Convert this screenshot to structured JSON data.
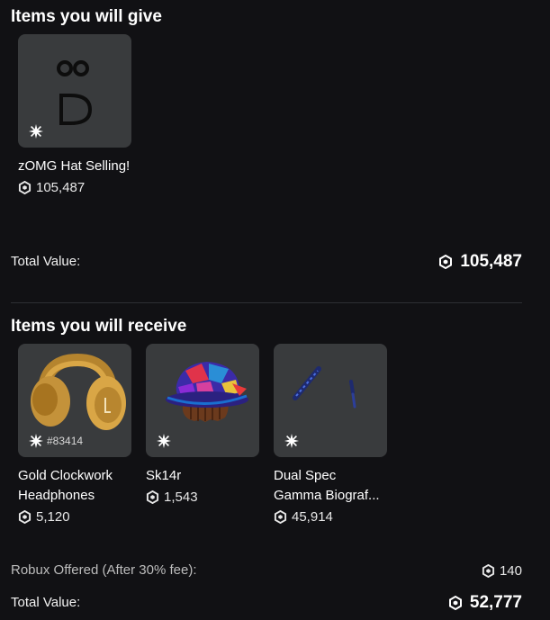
{
  "give": {
    "title": "Items you will give",
    "items": [
      {
        "name": "zOMG Hat Selling!",
        "price": "105,487",
        "serial": ""
      }
    ],
    "total_label": "Total Value:",
    "total_value": "105,487"
  },
  "receive": {
    "title": "Items you will receive",
    "items": [
      {
        "name": "Gold Clockwork Headphones",
        "price": "5,120",
        "serial": "#83414"
      },
      {
        "name": "Sk14r",
        "price": "1,543",
        "serial": ""
      },
      {
        "name": "Dual Spec Gamma Biograf...",
        "price": "45,914",
        "serial": ""
      }
    ],
    "robux_label": "Robux Offered (After 30% fee):",
    "robux_value": "140",
    "total_label": "Total Value:",
    "total_value": "52,777"
  },
  "colors": {
    "background": "#111114",
    "card": "#393b3d",
    "text": "#ffffff"
  },
  "icons": {
    "currency": "robux-icon",
    "limited": "sparkle-icon"
  }
}
